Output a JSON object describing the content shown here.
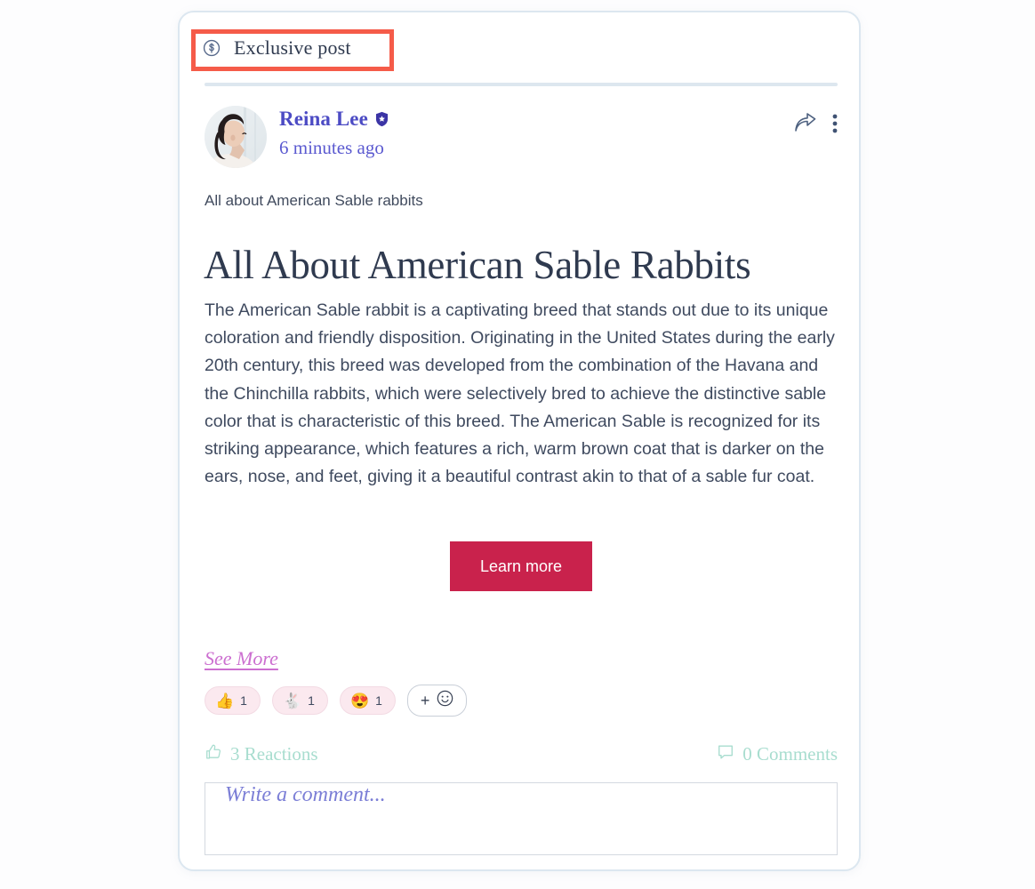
{
  "header": {
    "exclusive_label": "Exclusive post",
    "dollar_icon": "dollar-circle-icon"
  },
  "annotation": {
    "color": "#f55b49"
  },
  "author": {
    "name": "Reina Lee",
    "verified_badge_icon": "verified-shield-icon",
    "timestamp": "6 minutes ago",
    "avatar_icon": "user-avatar-photo",
    "share_icon": "share-arrow-icon",
    "more_icon": "more-vertical-icon"
  },
  "post": {
    "caption": "All about American Sable rabbits",
    "title": "All About American Sable Rabbits",
    "body": "The American Sable rabbit is a captivating breed that stands out due to its unique coloration and friendly disposition. Originating in the United States during the early 20th century, this breed was developed from the combination of the Havana and the Chinchilla rabbits, which were selectively bred to achieve the distinctive sable color that is characteristic of this breed. The American Sable is recognized for its striking appearance, which features a rich, warm brown coat that is darker on the ears, nose, and feet, giving it a beautiful contrast akin to that of a sable fur coat.",
    "cta_label": "Learn more",
    "cta_color": "#c9224c",
    "see_more_label": "See More",
    "see_more_color": "#cc6fd0"
  },
  "reactions": {
    "pills": [
      {
        "emoji": "👍",
        "name": "thumbs-up",
        "count": "1"
      },
      {
        "emoji": "🐇",
        "name": "rabbit",
        "count": "1"
      },
      {
        "emoji": "😍",
        "name": "heart-eyes",
        "count": "1"
      }
    ],
    "add_label": "+",
    "total_label": "3 Reactions",
    "comments_label": "0 Comments",
    "stat_color": "#a8ddcf"
  },
  "comment": {
    "placeholder": "Write a comment...",
    "value": ""
  }
}
